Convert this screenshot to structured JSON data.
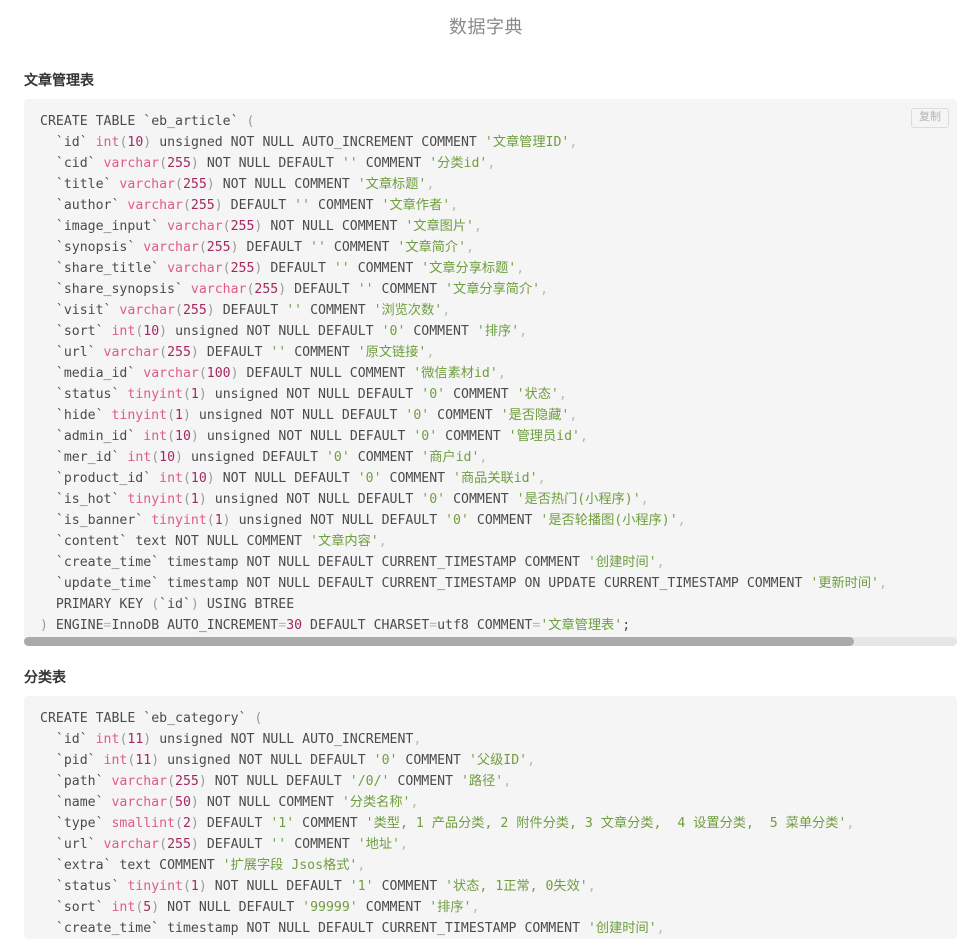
{
  "page": {
    "title": "数据字典"
  },
  "sections": [
    {
      "heading": "文章管理表",
      "copy_label": "复制",
      "has_scrollbar": true,
      "scroll_thumb_percent": 89,
      "code": "CREATE TABLE `eb_article` (\n  `id` int(10) unsigned NOT NULL AUTO_INCREMENT COMMENT '文章管理ID',\n  `cid` varchar(255) NOT NULL DEFAULT '' COMMENT '分类id',\n  `title` varchar(255) NOT NULL COMMENT '文章标题',\n  `author` varchar(255) DEFAULT '' COMMENT '文章作者',\n  `image_input` varchar(255) NOT NULL COMMENT '文章图片',\n  `synopsis` varchar(255) DEFAULT '' COMMENT '文章简介',\n  `share_title` varchar(255) DEFAULT '' COMMENT '文章分享标题',\n  `share_synopsis` varchar(255) DEFAULT '' COMMENT '文章分享简介',\n  `visit` varchar(255) DEFAULT '' COMMENT '浏览次数',\n  `sort` int(10) unsigned NOT NULL DEFAULT '0' COMMENT '排序',\n  `url` varchar(255) DEFAULT '' COMMENT '原文链接',\n  `media_id` varchar(100) DEFAULT NULL COMMENT '微信素材id',\n  `status` tinyint(1) unsigned NOT NULL DEFAULT '0' COMMENT '状态',\n  `hide` tinyint(1) unsigned NOT NULL DEFAULT '0' COMMENT '是否隐藏',\n  `admin_id` int(10) unsigned NOT NULL DEFAULT '0' COMMENT '管理员id',\n  `mer_id` int(10) unsigned DEFAULT '0' COMMENT '商户id',\n  `product_id` int(10) NOT NULL DEFAULT '0' COMMENT '商品关联id',\n  `is_hot` tinyint(1) unsigned NOT NULL DEFAULT '0' COMMENT '是否热门(小程序)',\n  `is_banner` tinyint(1) unsigned NOT NULL DEFAULT '0' COMMENT '是否轮播图(小程序)',\n  `content` text NOT NULL COMMENT '文章内容',\n  `create_time` timestamp NOT NULL DEFAULT CURRENT_TIMESTAMP COMMENT '创建时间',\n  `update_time` timestamp NOT NULL DEFAULT CURRENT_TIMESTAMP ON UPDATE CURRENT_TIMESTAMP COMMENT '更新时间',\n  PRIMARY KEY (`id`) USING BTREE\n) ENGINE=InnoDB AUTO_INCREMENT=30 DEFAULT CHARSET=utf8 COMMENT='文章管理表';"
    },
    {
      "heading": "分类表",
      "copy_label": "复制",
      "has_scrollbar": false,
      "scroll_thumb_percent": 0,
      "code": "CREATE TABLE `eb_category` (\n  `id` int(11) unsigned NOT NULL AUTO_INCREMENT,\n  `pid` int(11) unsigned NOT NULL DEFAULT '0' COMMENT '父级ID',\n  `path` varchar(255) NOT NULL DEFAULT '/0/' COMMENT '路径',\n  `name` varchar(50) NOT NULL COMMENT '分类名称',\n  `type` smallint(2) DEFAULT '1' COMMENT '类型, 1 产品分类, 2 附件分类, 3 文章分类,  4 设置分类,  5 菜单分类',\n  `url` varchar(255) DEFAULT '' COMMENT '地址',\n  `extra` text COMMENT '扩展字段 Jsos格式',\n  `status` tinyint(1) NOT NULL DEFAULT '1' COMMENT '状态, 1正常, 0失效',\n  `sort` int(5) NOT NULL DEFAULT '99999' COMMENT '排序',\n  `create_time` timestamp NOT NULL DEFAULT CURRENT_TIMESTAMP COMMENT '创建时间',"
    }
  ],
  "colors": {
    "type": "#e05c85",
    "number": "#a5275f",
    "string": "#6f9e3f",
    "plain": "#4b4b4b",
    "heading": "#333333",
    "title": "#8a8a8a",
    "code_bg": "#f5f5f5",
    "scrollbar_thumb": "#aaaaaa",
    "scrollbar_track": "#e6e6e6"
  }
}
